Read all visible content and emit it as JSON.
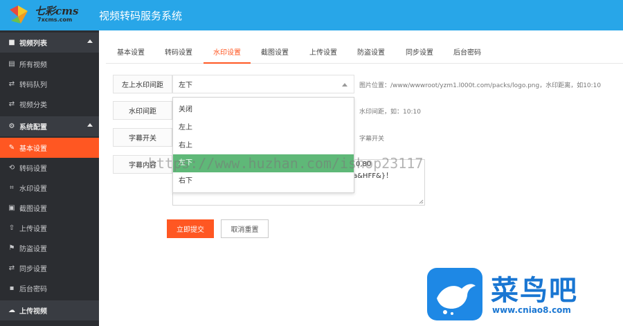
{
  "header": {
    "logo_text": "七彩cms",
    "logo_sub": "7xcms.com",
    "title": "视频转码服务系统"
  },
  "sidebar": {
    "items": [
      {
        "label": "视频列表",
        "icon": "video-icon",
        "glyph": "■",
        "group": true
      },
      {
        "label": "所有视频",
        "icon": "list-icon",
        "glyph": "▤"
      },
      {
        "label": "转码队列",
        "icon": "exchange-icon",
        "glyph": "⇄"
      },
      {
        "label": "视频分类",
        "icon": "exchange-icon",
        "glyph": "⇄"
      },
      {
        "label": "系统配置",
        "icon": "gear-icon",
        "glyph": "⚙",
        "group": true
      },
      {
        "label": "基本设置",
        "icon": "edit-icon",
        "glyph": "✎",
        "active": true
      },
      {
        "label": "转码设置",
        "icon": "refresh-icon",
        "glyph": "⟲"
      },
      {
        "label": "水印设置",
        "icon": "crop-icon",
        "glyph": "⌗"
      },
      {
        "label": "截图设置",
        "icon": "image-icon",
        "glyph": "▣"
      },
      {
        "label": "上传设置",
        "icon": "upload-icon",
        "glyph": "⇧"
      },
      {
        "label": "防盗设置",
        "icon": "flag-icon",
        "glyph": "⚑"
      },
      {
        "label": "同步设置",
        "icon": "exchange-icon",
        "glyph": "⇄"
      },
      {
        "label": "后台密码",
        "icon": "lock-icon",
        "glyph": "▪"
      },
      {
        "label": "上传视频",
        "icon": "cloud-upload-icon",
        "glyph": "☁",
        "group": true
      }
    ]
  },
  "tabs": [
    "基本设置",
    "转码设置",
    "水印设置",
    "截图设置",
    "上传设置",
    "防盗设置",
    "同步设置",
    "后台密码"
  ],
  "form": {
    "position_label": "左上水印间距",
    "position_value": "左下",
    "position_hint": "图片位置：/www/wwwroot/yzm1.l000t.com/packs/logo.png，水印距离，如10:10",
    "spacing_label": "水印间距",
    "spacing_hint": "水印间距，如：10:10",
    "subtitle_label": "字幕开关",
    "subtitle_hint": "字幕开关",
    "subtitle_content_label": "字幕内容",
    "textarea_line1": "0,80",
    "textarea_line2": "a&HFF&}！"
  },
  "dropdown": {
    "options": [
      "关闭",
      "左上",
      "右上",
      "左下",
      "右下"
    ],
    "hovered_index": 3
  },
  "buttons": {
    "submit": "立即提交",
    "reset": "取消重置"
  },
  "watermark_text": "https://www.huzhan.com/ishop23117",
  "badge": {
    "name": "菜鸟吧",
    "url": "www.cniao8.com"
  },
  "colors": {
    "header": "#28a6e8",
    "sidebar": "#2b2d31",
    "accent": "#ff5722",
    "hover": "#5fb878"
  }
}
